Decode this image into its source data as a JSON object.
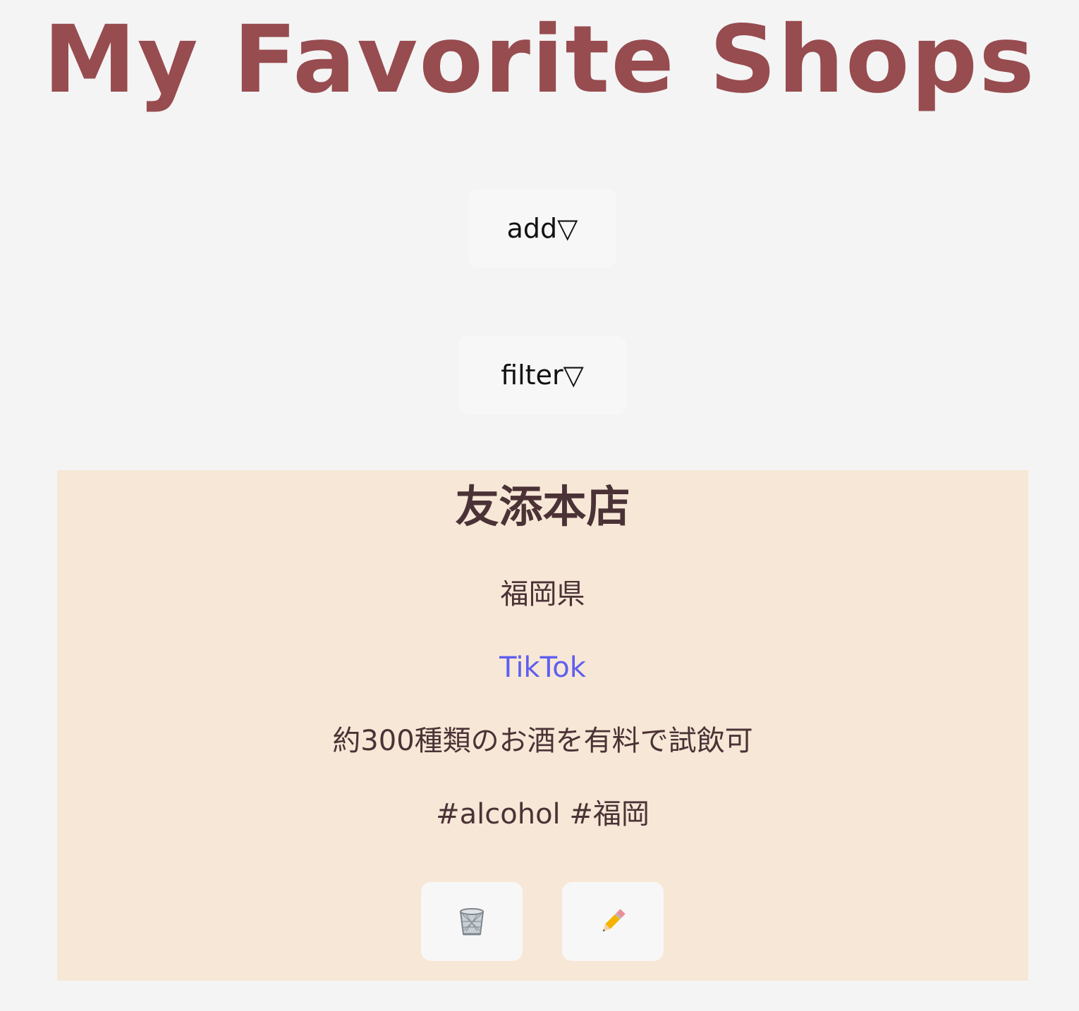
{
  "header": {
    "title": "My Favorite Shops"
  },
  "controls": {
    "add_label": "add▽",
    "filter_label": "filter▽"
  },
  "shop": {
    "name": "友添本店",
    "prefecture": "福岡県",
    "link_label": "TikTok",
    "note": "約300種類のお酒を有料で試飲可",
    "tags": "#alcohol #福岡",
    "delete_icon": "trash-icon",
    "edit_icon": "pencil-icon"
  },
  "colors": {
    "background": "#f4f4f4",
    "title": "#974c4f",
    "card_background": "#f7e7d6",
    "card_text": "#4a3236",
    "link": "#5e5ff0",
    "button_background": "#f7f7f7"
  }
}
